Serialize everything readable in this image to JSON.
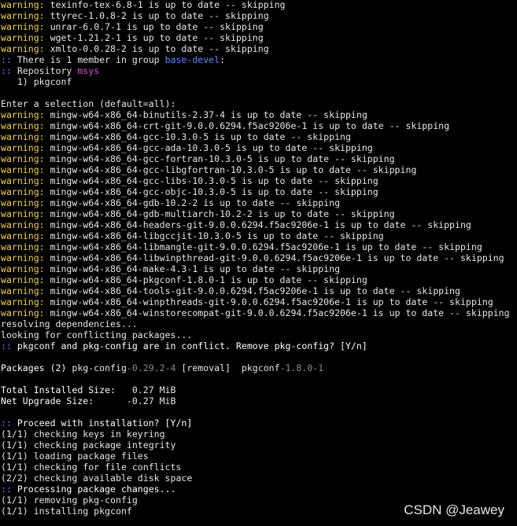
{
  "terminal": {
    "lines": [
      [
        {
          "t": "warning:",
          "s": "w"
        },
        {
          "t": " texinfo-tex-6.8-1 is up to date -- skipping"
        }
      ],
      [
        {
          "t": "warning:",
          "s": "w"
        },
        {
          "t": " ttyrec-1.0.8-2 is up to date -- skipping"
        }
      ],
      [
        {
          "t": "warning:",
          "s": "w"
        },
        {
          "t": " unrar-6.0.7-1 is up to date -- skipping"
        }
      ],
      [
        {
          "t": "warning:",
          "s": "w"
        },
        {
          "t": " wget-1.21.2-1 is up to date -- skipping"
        }
      ],
      [
        {
          "t": "warning:",
          "s": "w"
        },
        {
          "t": " xmlto-0.0.28-2 is up to date -- skipping"
        }
      ],
      [
        {
          "t": "::",
          "s": "c"
        },
        {
          "t": " There is 1 member in group "
        },
        {
          "t": "base-devel",
          "s": "c"
        },
        {
          "t": ":"
        }
      ],
      [
        {
          "t": ":: ",
          "s": "c"
        },
        {
          "t": "Repository "
        },
        {
          "t": "msys",
          "s": "m"
        }
      ],
      [
        {
          "t": "   1) pkgconf"
        }
      ],
      [
        {
          "t": ""
        }
      ],
      [
        {
          "t": "Enter a selection (default=all):"
        }
      ],
      [
        {
          "t": "warning:",
          "s": "w"
        },
        {
          "t": " mingw-w64-x86_64-binutils-2.37-4 is up to date -- skipping"
        }
      ],
      [
        {
          "t": "warning:",
          "s": "w"
        },
        {
          "t": " mingw-w64-x86_64-crt-git-9.0.0.6294.f5ac9206e-1 is up to date -- skipping"
        }
      ],
      [
        {
          "t": "warning:",
          "s": "w"
        },
        {
          "t": " mingw-w64-x86_64-gcc-10.3.0-5 is up to date -- skipping"
        }
      ],
      [
        {
          "t": "warning:",
          "s": "w"
        },
        {
          "t": " mingw-w64-x86_64-gcc-ada-10.3.0-5 is up to date -- skipping"
        }
      ],
      [
        {
          "t": "warning:",
          "s": "w"
        },
        {
          "t": " mingw-w64-x86_64-gcc-fortran-10.3.0-5 is up to date -- skipping"
        }
      ],
      [
        {
          "t": "warning:",
          "s": "w"
        },
        {
          "t": " mingw-w64-x86_64-gcc-libgfortran-10.3.0-5 is up to date -- skipping"
        }
      ],
      [
        {
          "t": "warning:",
          "s": "w"
        },
        {
          "t": " mingw-w64-x86_64-gcc-libs-10.3.0-5 is up to date -- skipping"
        }
      ],
      [
        {
          "t": "warning:",
          "s": "w"
        },
        {
          "t": " mingw-w64-x86_64-gcc-objc-10.3.0-5 is up to date -- skipping"
        }
      ],
      [
        {
          "t": "warning:",
          "s": "w"
        },
        {
          "t": " mingw-w64-x86_64-gdb-10.2-2 is up to date -- skipping"
        }
      ],
      [
        {
          "t": "warning:",
          "s": "w"
        },
        {
          "t": " mingw-w64-x86_64-gdb-multiarch-10.2-2 is up to date -- skipping"
        }
      ],
      [
        {
          "t": "warning:",
          "s": "w"
        },
        {
          "t": " mingw-w64-x86_64-headers-git-9.0.0.6294.f5ac9206e-1 is up to date -- skipping"
        }
      ],
      [
        {
          "t": "warning:",
          "s": "w"
        },
        {
          "t": " mingw-w64-x86_64-libgccjit-10.3.0-5 is up to date -- skipping"
        }
      ],
      [
        {
          "t": "warning:",
          "s": "w"
        },
        {
          "t": " mingw-w64-x86_64-libmangle-git-9.0.0.6294.f5ac9206e-1 is up to date -- skipping"
        }
      ],
      [
        {
          "t": "warning:",
          "s": "w"
        },
        {
          "t": " mingw-w64-x86_64-libwinpthread-git-9.0.0.6294.f5ac9206e-1 is up to date -- skipping"
        }
      ],
      [
        {
          "t": "warning:",
          "s": "w"
        },
        {
          "t": " mingw-w64-x86_64-make-4.3-1 is up to date -- skipping"
        }
      ],
      [
        {
          "t": "warning:",
          "s": "w"
        },
        {
          "t": " mingw-w64-x86_64-pkgconf-1.8.0-1 is up to date -- skipping"
        }
      ],
      [
        {
          "t": "warning:",
          "s": "w"
        },
        {
          "t": " mingw-w64-x86_64-tools-git-9.0.0.6294.f5ac9206e-1 is up to date -- skipping"
        }
      ],
      [
        {
          "t": "warning:",
          "s": "w"
        },
        {
          "t": " mingw-w64-x86_64-winpthreads-git-9.0.0.6294.f5ac9206e-1 is up to date -- skipping"
        }
      ],
      [
        {
          "t": "warning:",
          "s": "w"
        },
        {
          "t": " mingw-w64-x86_64-winstorecompat-git-9.0.0.6294.f5ac9206e-1 is up to date -- skipping"
        }
      ],
      [
        {
          "t": "resolving dependencies..."
        }
      ],
      [
        {
          "t": "looking for conflicting packages..."
        }
      ],
      [
        {
          "t": "::",
          "s": "c"
        },
        {
          "t": " pkgconf and pkg-config are in conflict. Remove pkg-config? [Y/n]",
          "s": "b"
        }
      ],
      [
        {
          "t": ""
        }
      ],
      [
        {
          "t": "Packages (2) ",
          "s": "b"
        },
        {
          "t": "pkg-config"
        },
        {
          "t": "-0.29.2-4",
          "s": "g"
        },
        {
          "t": " [removal]  "
        },
        {
          "t": "pkgconf"
        },
        {
          "t": "-1.8.0-1",
          "s": "g"
        }
      ],
      [
        {
          "t": ""
        }
      ],
      [
        {
          "t": "Total Installed Size:",
          "s": "b"
        },
        {
          "t": "   0.27 MiB"
        }
      ],
      [
        {
          "t": "Net Upgrade Size:",
          "s": "b"
        },
        {
          "t": "      -0.27 MiB"
        }
      ],
      [
        {
          "t": ""
        }
      ],
      [
        {
          "t": "::",
          "s": "c"
        },
        {
          "t": " Proceed with installation? [Y/n]",
          "s": "b"
        }
      ],
      [
        {
          "t": "(1/1) checking keys in keyring"
        }
      ],
      [
        {
          "t": "(1/1) checking package integrity"
        }
      ],
      [
        {
          "t": "(1/1) loading package files"
        }
      ],
      [
        {
          "t": "(1/1) checking for file conflicts"
        }
      ],
      [
        {
          "t": "(2/2) checking available disk space"
        }
      ],
      [
        {
          "t": "::",
          "s": "c"
        },
        {
          "t": " Processing package changes...",
          "s": "b"
        }
      ],
      [
        {
          "t": "(1/1) removing pkg-config"
        }
      ],
      [
        {
          "t": "(1/1) installing pkgconf"
        }
      ]
    ]
  },
  "watermark": "CSDN @Jeawey",
  "colors": {
    "background": "#000000",
    "text": "#e6e6e6",
    "warning": "#f5d23a",
    "prompt": "#5b8cff",
    "repository": "#d357d3",
    "version": "#8a8a8a"
  }
}
